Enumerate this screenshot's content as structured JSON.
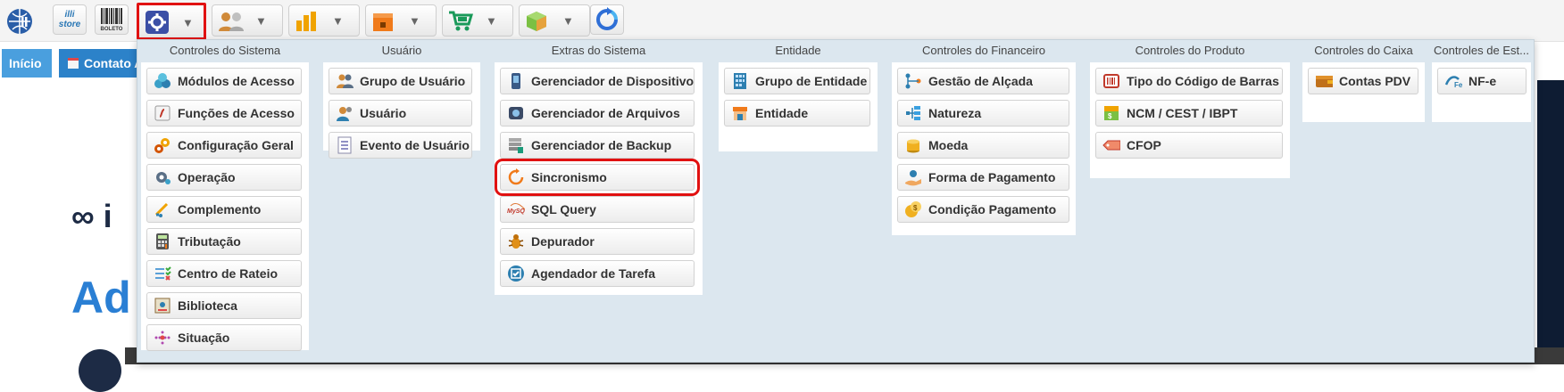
{
  "toolbar": {
    "store_label_top": "illi",
    "store_label_bottom": "store",
    "boleto_label": "BOLETO",
    "caret": "▼"
  },
  "tabs": [
    {
      "label": "Início"
    },
    {
      "label": "Contato A"
    }
  ],
  "background": {
    "logo_text": "∞ i",
    "heading_text": "Ad"
  },
  "menu": {
    "columns": [
      {
        "title": "Controles do Sistema",
        "items": [
          {
            "label": "Módulos de Acesso",
            "icon": "modules-icon"
          },
          {
            "label": "Funções de Acesso",
            "icon": "functions-icon"
          },
          {
            "label": "Configuração Geral",
            "icon": "gears-icon"
          },
          {
            "label": "Operação",
            "icon": "operation-icon"
          },
          {
            "label": "Complemento",
            "icon": "complement-icon"
          },
          {
            "label": "Tributação",
            "icon": "calculator-icon"
          },
          {
            "label": "Centro de Rateio",
            "icon": "checklist-icon"
          },
          {
            "label": "Biblioteca",
            "icon": "library-icon"
          },
          {
            "label": "Situação",
            "icon": "situation-icon"
          }
        ]
      },
      {
        "title": "Usuário",
        "items": [
          {
            "label": "Grupo de Usuário",
            "icon": "user-group-icon"
          },
          {
            "label": "Usuário",
            "icon": "user-icon"
          },
          {
            "label": "Evento de Usuário",
            "icon": "user-event-icon"
          }
        ]
      },
      {
        "title": "Extras do Sistema",
        "items": [
          {
            "label": "Gerenciador de Dispositivo",
            "icon": "device-icon"
          },
          {
            "label": "Gerenciador de Arquivos",
            "icon": "file-manager-icon"
          },
          {
            "label": "Gerenciador de Backup",
            "icon": "backup-icon"
          },
          {
            "label": "Sincronismo",
            "icon": "sync-icon"
          },
          {
            "label": "SQL Query",
            "icon": "mysql-icon"
          },
          {
            "label": "Depurador",
            "icon": "bug-icon"
          },
          {
            "label": "Agendador de Tarefa",
            "icon": "task-scheduler-icon"
          }
        ]
      },
      {
        "title": "Entidade",
        "items": [
          {
            "label": "Grupo de Entidade",
            "icon": "entity-group-icon"
          },
          {
            "label": "Entidade",
            "icon": "store-icon"
          }
        ]
      },
      {
        "title": "Controles do Financeiro",
        "items": [
          {
            "label": "Gestão de Alçada",
            "icon": "hierarchy-icon"
          },
          {
            "label": "Natureza",
            "icon": "nature-icon"
          },
          {
            "label": "Moeda",
            "icon": "coins-icon"
          },
          {
            "label": "Forma de Pagamento",
            "icon": "payment-hand-icon"
          },
          {
            "label": "Condição Pagamento",
            "icon": "payment-condition-icon"
          }
        ]
      },
      {
        "title": "Controles do Produto",
        "items": [
          {
            "label": "Tipo do Código de Barras",
            "icon": "barcode-icon"
          },
          {
            "label": "NCM / CEST / IBPT",
            "icon": "ncm-icon"
          },
          {
            "label": "CFOP",
            "icon": "tag-icon"
          }
        ]
      },
      {
        "title": "Controles do Caixa",
        "items": [
          {
            "label": "Contas PDV",
            "icon": "wallet-icon"
          }
        ]
      },
      {
        "title": "Controles de Est...",
        "items": [
          {
            "label": "NF-e",
            "icon": "nfe-icon"
          }
        ]
      }
    ]
  },
  "colors": {
    "accent": "#2c82c9",
    "highlight": "#e11111",
    "menu_bg": "#dce7ef"
  }
}
